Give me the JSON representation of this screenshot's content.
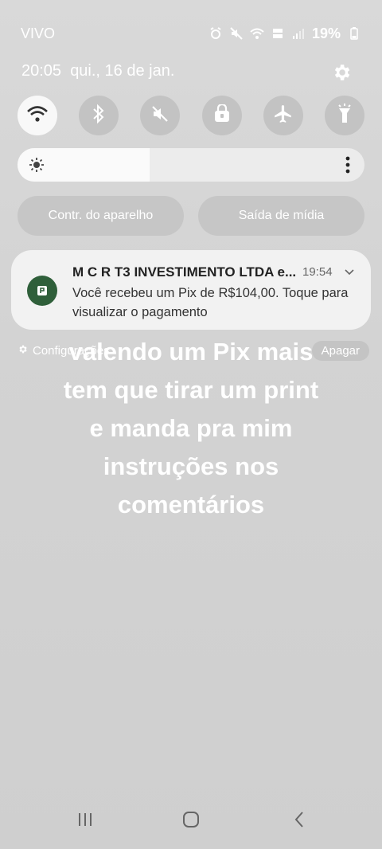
{
  "status": {
    "carrier": "VIVO",
    "battery": "19%"
  },
  "header": {
    "time": "20:05",
    "date": "qui., 16 de jan."
  },
  "quick_settings": [
    "wifi-icon",
    "bluetooth-icon",
    "mute-icon",
    "rotation-lock-icon",
    "airplane-icon",
    "flashlight-icon"
  ],
  "brightness": {
    "level": 0.38
  },
  "buttons": {
    "device_control": "Contr. do aparelho",
    "media_output": "Saída de mídia"
  },
  "notification": {
    "title": "M C R T3 INVESTIMENTO LTDA e...",
    "time": "19:54",
    "body": "Você recebeu um Pix de R$104,00. Toque para visualizar o pagamento"
  },
  "notif_actions": {
    "settings": "Configurações",
    "clear": "Apagar"
  },
  "overlay": {
    "line1": "valendo um Pix mais",
    "line2": "tem que tirar um print",
    "line3": "e manda pra mim",
    "line4": "instruções nos",
    "line5": "comentários"
  }
}
